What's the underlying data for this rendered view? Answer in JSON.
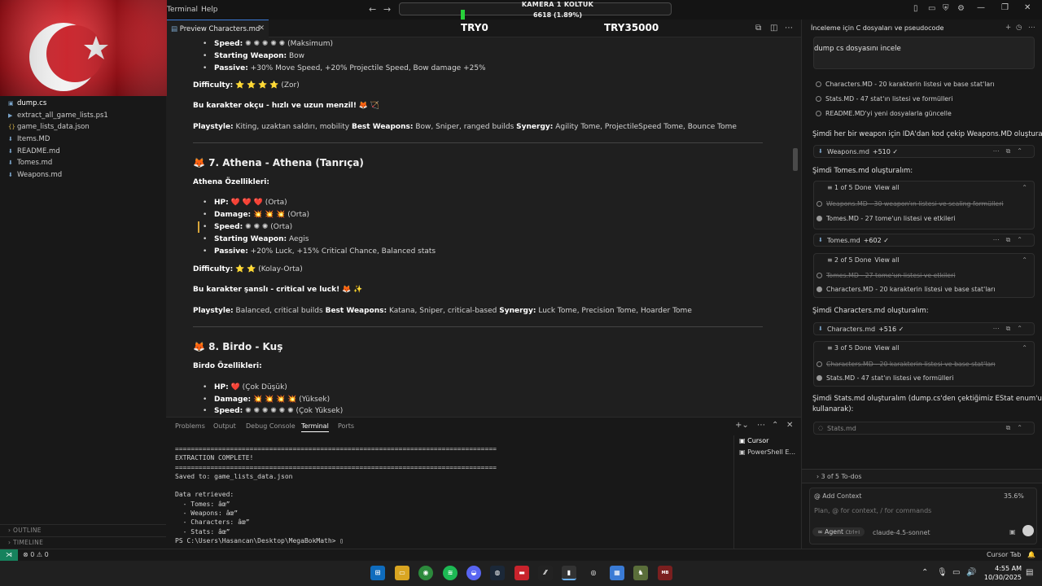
{
  "titlebar": {
    "menus": [
      "Terminal",
      "Help"
    ],
    "overlay_title": "KAMERA 1 KOLTUK",
    "overlay_progress": "6618 (1.89%)",
    "overlay_progress_fraction": 0.0189
  },
  "explorer": {
    "files": [
      {
        "name": "dump.cs",
        "icon": "cs-file-icon",
        "active": true
      },
      {
        "name": "extract_all_game_lists.ps1",
        "icon": "powershell-file-icon"
      },
      {
        "name": "game_lists_data.json",
        "icon": "json-file-icon"
      },
      {
        "name": "Items.MD",
        "icon": "markdown-file-icon"
      },
      {
        "name": "README.md",
        "icon": "markdown-file-icon"
      },
      {
        "name": "Tomes.md",
        "icon": "markdown-file-icon"
      },
      {
        "name": "Weapons.md",
        "icon": "markdown-file-icon"
      }
    ],
    "outline_label": "OUTLINE",
    "timeline_label": "TIMELINE"
  },
  "editor": {
    "tab_label": "Preview Characters.md",
    "price_left": "TRY0",
    "price_right": "TRY35000",
    "doc": {
      "prev_speed_label": "Speed:",
      "prev_speed_value": "(Maksimum)",
      "prev_weapon_label": "Starting Weapon:",
      "prev_weapon_value": "Bow",
      "prev_passive_label": "Passive:",
      "prev_passive_value": "+30% Move Speed, +20% Projectile Speed, Bow damage +25%",
      "prev_difficulty_label": "Difficulty:",
      "prev_difficulty_value": "⭐ ⭐ ⭐ ⭐ (Zor)",
      "prev_tagline": "Bu karakter okçu - hızlı ve uzun menzil!",
      "prev_playstyle_label": "Playstyle:",
      "prev_playstyle_value": "Kiting, uzaktan saldırı, mobility",
      "prev_weapons_label": "Best Weapons:",
      "prev_weapons_value": "Bow, Sniper, ranged builds",
      "prev_synergy_label": "Synergy:",
      "prev_synergy_value": "Agility Tome, ProjectileSpeed Tome, Bounce Tome",
      "athena_heading": "7. Athena - Athena (Tanrıça)",
      "athena_sub": "Athena Özellikleri:",
      "athena_hp_label": "HP:",
      "athena_hp_value": "❤️ ❤️ ❤️ (Orta)",
      "athena_dmg_label": "Damage:",
      "athena_dmg_value": "💥 💥 💥 (Orta)",
      "athena_speed_label": "Speed:",
      "athena_speed_value": "(Orta)",
      "athena_weapon_label": "Starting Weapon:",
      "athena_weapon_value": "Aegis",
      "athena_passive_label": "Passive:",
      "athena_passive_value": "+20% Luck, +15% Critical Chance, Balanced stats",
      "athena_difficulty_label": "Difficulty:",
      "athena_difficulty_value": "⭐ ⭐ (Kolay-Orta)",
      "athena_tagline": "Bu karakter şanslı - critical ve luck!",
      "athena_playstyle_label": "Playstyle:",
      "athena_playstyle_value": "Balanced, critical builds",
      "athena_weapons_label": "Best Weapons:",
      "athena_weapons_value": "Katana, Sniper, critical-based",
      "athena_synergy_label": "Synergy:",
      "athena_synergy_value": "Luck Tome, Precision Tome, Hoarder Tome",
      "birdo_heading": "8. Birdo - Kuş",
      "birdo_sub": "Birdo Özellikleri:",
      "birdo_hp_label": "HP:",
      "birdo_hp_value": "❤️ (Çok Düşük)",
      "birdo_dmg_label": "Damage:",
      "birdo_dmg_value": "💥 💥 💥 💥 (Yüksek)",
      "birdo_speed_label": "Speed:",
      "birdo_speed_value": "(Çok Yüksek)"
    }
  },
  "panel": {
    "tabs": [
      "Problems",
      "Output",
      "Debug Console",
      "Terminal",
      "Ports"
    ],
    "active_tab": "Terminal",
    "terminal_lines": [
      "==================================================================================",
      "EXTRACTION COMPLETE!",
      "==================================================================================",
      "Saved to: game_lists_data.json",
      "",
      "Data retrieved:",
      "  - Tomes: âœ”",
      "  - Weapons: âœ”",
      "  - Characters: âœ”",
      "  - Stats: âœ”"
    ],
    "prompt": "PS C:\\Users\\Hasancan\\Desktop\\MegaBokMath> ",
    "terminals": [
      "Cursor",
      "PowerShell E..."
    ]
  },
  "chat": {
    "title": "İnceleme için C dosyaları ve pseudocode",
    "user_message": "dump cs dosyasını incele",
    "todos_top": [
      {
        "text": "Characters.MD - 20 karakterin listesi ve base stat'ları",
        "state": "pending"
      },
      {
        "text": "Stats.MD - 47 stat'ın listesi ve formülleri",
        "state": "pending"
      },
      {
        "text": "README.MD'yi yeni dosyalarla güncelle",
        "state": "pending"
      }
    ],
    "msg_weapons": "Şimdi her bir weapon için IDA'dan kod çekip Weapons.MD oluşturalım:",
    "file_weapons": {
      "name": "Weapons.md",
      "delta": "+510 ✓"
    },
    "msg_tomes": "Şimdi Tomes.md oluşturalım:",
    "card1": {
      "progress": "1 of 5 Done",
      "view_all": "View all",
      "items": [
        {
          "text": "Weapons.MD - 30 weapon'ın listesi ve scaling formülleri",
          "state": "done"
        },
        {
          "text": "Tomes.MD - 27 tome'un listesi ve etkileri",
          "state": "active"
        }
      ]
    },
    "file_tomes": {
      "name": "Tomes.md",
      "delta": "+602 ✓"
    },
    "card2": {
      "progress": "2 of 5 Done",
      "view_all": "View all",
      "items": [
        {
          "text": "Tomes.MD - 27 tome'un listesi ve etkileri",
          "state": "done"
        },
        {
          "text": "Characters.MD - 20 karakterin listesi ve base stat'ları",
          "state": "active"
        }
      ]
    },
    "msg_characters": "Şimdi Characters.md oluşturalım:",
    "file_characters": {
      "name": "Characters.md",
      "delta": "+516 ✓"
    },
    "card3": {
      "progress": "3 of 5 Done",
      "view_all": "View all",
      "items": [
        {
          "text": "Characters.MD - 20 karakterin listesi ve base stat'ları",
          "state": "done"
        },
        {
          "text": "Stats.MD - 47 stat'ın listesi ve formülleri",
          "state": "active"
        }
      ]
    },
    "msg_stats_1": "Şimdi Stats.md oluşturalım (dump.cs'den çektiğimiz EStat enum'unu",
    "msg_stats_2": "kullanarak):",
    "file_stats": {
      "name": "Stats.md"
    },
    "todos_summary": "3 of 5 To-dos",
    "add_context": "@ Add Context",
    "context_percent": "35.6%",
    "input_placeholder": "Plan, @ for context, / for commands",
    "agent_label": "Agent",
    "agent_shortcut": "Ctrl+I",
    "model": "claude-4.5-sonnet"
  },
  "statusbar": {
    "problems": "⊗ 0 ⚠ 0",
    "cursor_tab": "Cursor Tab"
  },
  "taskbar": {
    "time": "4:55 AM",
    "date": "10/30/2025"
  }
}
